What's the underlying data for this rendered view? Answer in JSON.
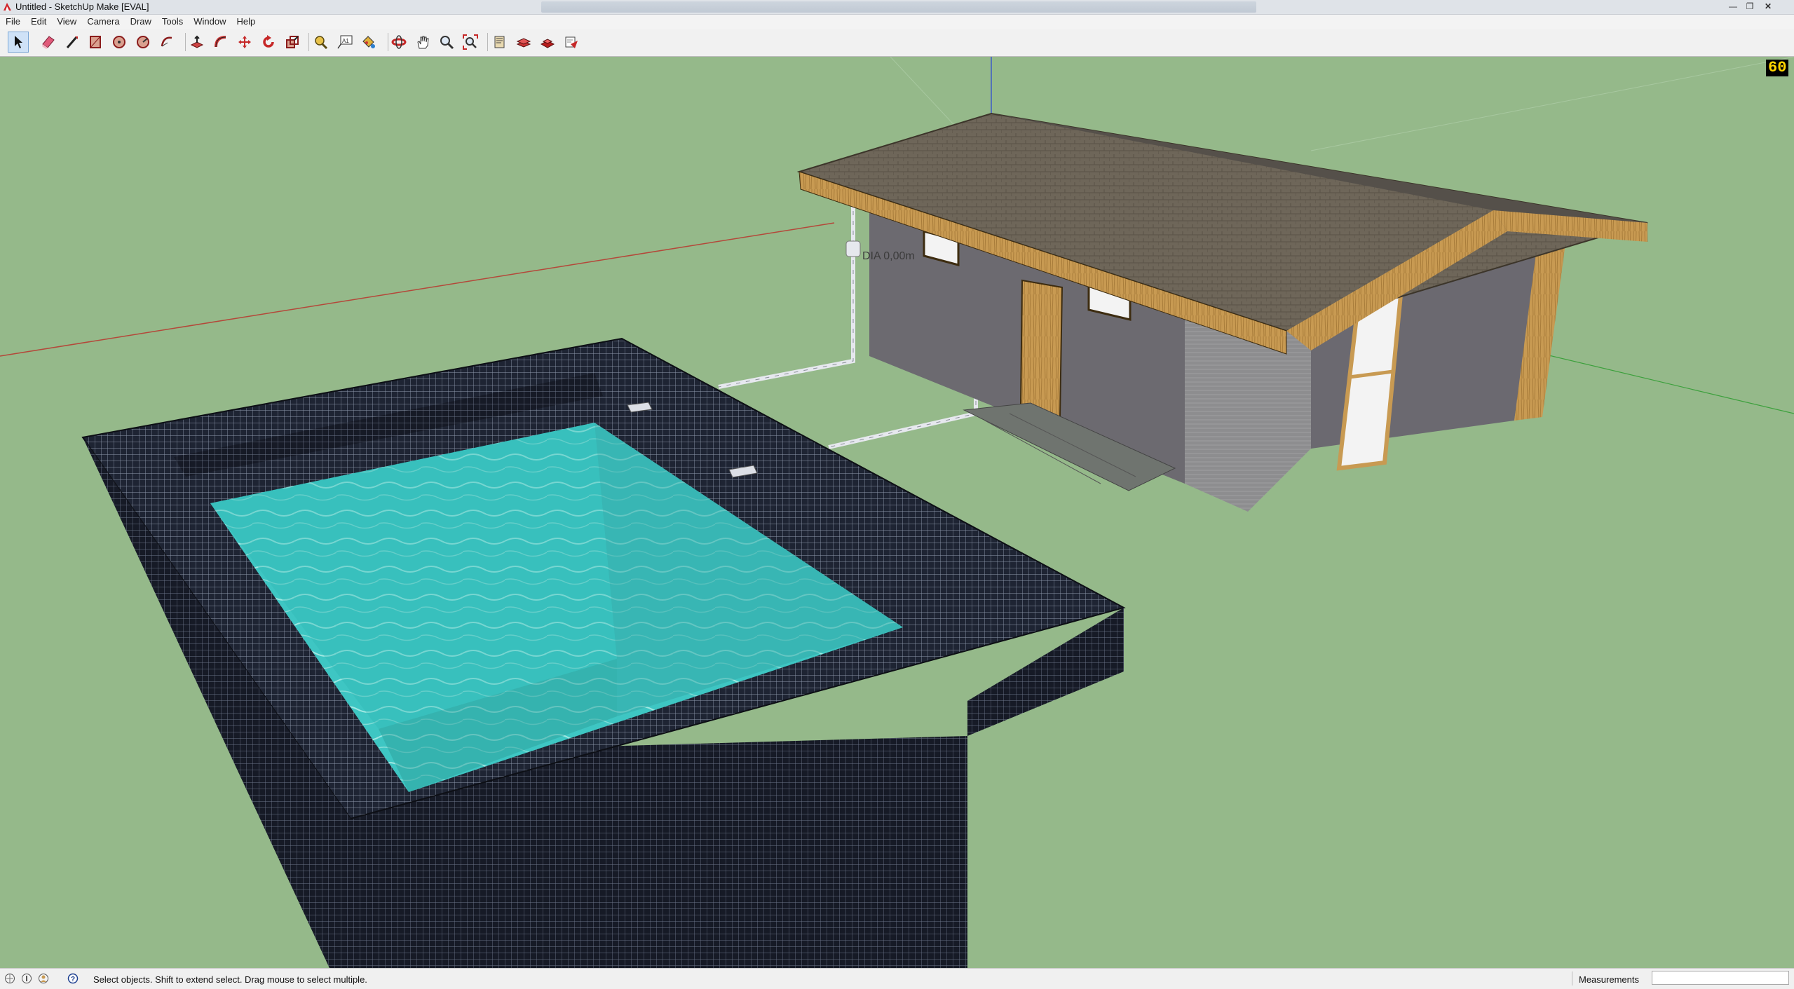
{
  "window": {
    "title": "Untitled - SketchUp Make [EVAL]",
    "controls": [
      "minimize-icon",
      "maximize-icon",
      "close-icon"
    ]
  },
  "menubar": {
    "items": [
      "File",
      "Edit",
      "View",
      "Camera",
      "Draw",
      "Tools",
      "Window",
      "Help"
    ]
  },
  "toolbar": {
    "tools": [
      "select",
      "eraser",
      "line",
      "rectangle",
      "circle",
      "arc",
      "arc-2",
      "push-pull",
      "follow-me",
      "move",
      "rotate",
      "scale",
      "tape-measure",
      "text",
      "paint-bucket",
      "orbit",
      "pan",
      "zoom",
      "zoom-extents",
      "3d-warehouse",
      "extension-warehouse",
      "share-model",
      "send-to-layout"
    ],
    "active": "select"
  },
  "viewport": {
    "dimension_label": "DIA 0,00m",
    "fps_counter": "60",
    "colors": {
      "ground": "#95b98a",
      "water": "#3ec6c3",
      "tile": "#1e2433",
      "roof": "#6e6659",
      "wall": "#6c6a70",
      "wood": "#c89a52"
    }
  },
  "statusbar": {
    "message": "Select objects. Shift to extend select. Drag mouse to select multiple.",
    "measurements_label": "Measurements",
    "measurements_value": ""
  }
}
